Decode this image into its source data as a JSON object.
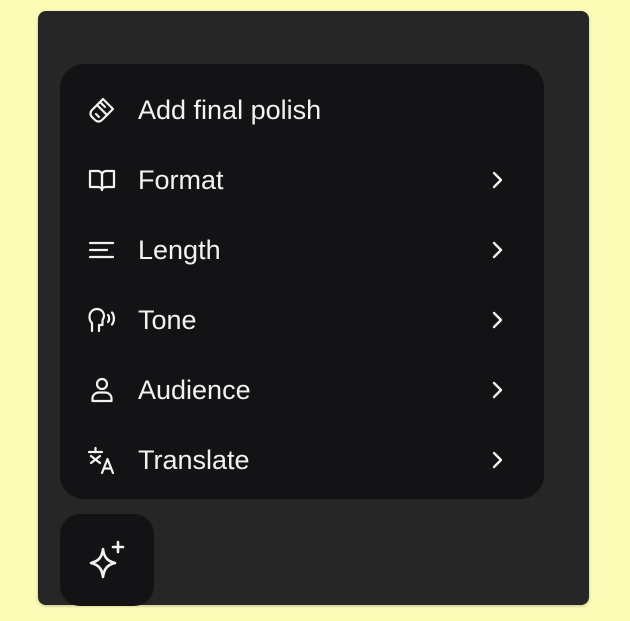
{
  "menu": {
    "items": [
      {
        "label": "Add final polish",
        "icon": "paintbrush-icon",
        "has_submenu": false
      },
      {
        "label": "Format",
        "icon": "book-open-icon",
        "has_submenu": true
      },
      {
        "label": "Length",
        "icon": "text-lines-icon",
        "has_submenu": true
      },
      {
        "label": "Tone",
        "icon": "speaking-head-icon",
        "has_submenu": true
      },
      {
        "label": "Audience",
        "icon": "user-icon",
        "has_submenu": true
      },
      {
        "label": "Translate",
        "icon": "translate-icon",
        "has_submenu": true
      }
    ]
  },
  "fab": {
    "icon": "sparkles-icon"
  },
  "colors": {
    "page_background": "#fdfdb8",
    "panel_background": "#262626",
    "menu_background": "#131316",
    "text": "#f2f2f2"
  }
}
